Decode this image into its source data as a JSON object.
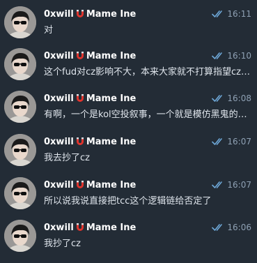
{
  "colors": {
    "background": "#232c36",
    "sender": "#ffffff",
    "text": "#dfe5ec",
    "meta": "#8ea0b3",
    "read_check": "#6ea8d8",
    "magnet_red": "#e0342d"
  },
  "messages": [
    {
      "sender_prefix": "0xwill",
      "sender_suffix": "Mame Ine",
      "sender_icon": "magnet-icon",
      "status_icon": "double-check-icon",
      "time": "16:11",
      "text": "对"
    },
    {
      "sender_prefix": "0xwill",
      "sender_suffix": "Mame Ine",
      "sender_icon": "magnet-icon",
      "status_icon": "double-check-icon",
      "time": "16:10",
      "text": "这个fud对cz影响不大，本来大家就不打算指望cz亲自下场"
    },
    {
      "sender_prefix": "0xwill",
      "sender_suffix": "Mame Ine",
      "sender_icon": "magnet-icon",
      "status_icon": "double-check-icon",
      "time": "16:08",
      "text": "有啊，一个是kol空投叙事，一个就是模仿黑鬼的纯情绪"
    },
    {
      "sender_prefix": "0xwill",
      "sender_suffix": "Mame Ine",
      "sender_icon": "magnet-icon",
      "status_icon": "double-check-icon",
      "time": "16:07",
      "text": "我去抄了cz"
    },
    {
      "sender_prefix": "0xwill",
      "sender_suffix": "Mame Ine",
      "sender_icon": "magnet-icon",
      "status_icon": "double-check-icon",
      "time": "16:07",
      "text": "所以说我说直接把tcc这个逻辑链给否定了"
    },
    {
      "sender_prefix": "0xwill",
      "sender_suffix": "Mame Ine",
      "sender_icon": "magnet-icon",
      "status_icon": "double-check-icon",
      "time": "16:06",
      "text": "我抄了cz"
    }
  ]
}
